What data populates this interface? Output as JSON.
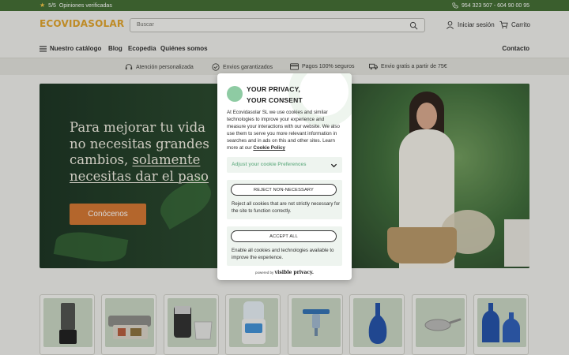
{
  "topbar": {
    "rating": "5/5",
    "reviews": "Opiniones verificadas",
    "phone": "954 323 507 - 604 90 00 95"
  },
  "header": {
    "logo": "ECOVIDASOLAR",
    "search_placeholder": "Buscar",
    "account": "Iniciar sesión",
    "cart": "Carrito"
  },
  "nav": {
    "catalog": "Nuestro catálogo",
    "links": [
      "Blog",
      "Ecopedia",
      "Quiénes somos"
    ],
    "contact": "Contacto"
  },
  "benefits": [
    {
      "icon": "headset-icon",
      "label": "Atención personalizada"
    },
    {
      "icon": "check-circle-icon",
      "label": "Envios garantizados"
    },
    {
      "icon": "credit-card-icon",
      "label": "Pagos 100% seguros"
    },
    {
      "icon": "truck-icon",
      "label": "Envio gratis a partir de 75€"
    }
  ],
  "hero": {
    "line1": "Para mejorar tu vida",
    "line2": "no necesitas grandes",
    "line3": "cambios,",
    "line3_underlined": "solamente",
    "line4_underlined": "necesitas dar el paso",
    "cta": "Conócenos"
  },
  "consent": {
    "title_line1": "YOUR PRIVACY,",
    "title_line2": "YOUR CONSENT",
    "body": "At Ecovidasolar SL we use cookies and similar technologies to improve your experience and measure your interactions with our website. We also use them to serve you more relevant information in searches and in ads on this and other sites. Learn more at our",
    "policy_link": "Cookie Policy",
    "adjust": "Adjust your cookie Preferences",
    "reject_button": "REJECT NON-NECESSARY",
    "reject_desc": "Reject all cookies that are not strictly necessary for the site to function correctly.",
    "accept_button": "ACCEPT ALL",
    "accept_desc": "Enable all cookies and technologies available to improve the experience.",
    "powered_by": "powered by",
    "powered_brand": "visible privacy."
  },
  "colors": {
    "topbar": "#3f6b2f",
    "accent_orange": "#d4742e",
    "consent_green": "#8ecba3",
    "logo_yellow": "#e0a126"
  },
  "products": [
    {
      "name": "blender"
    },
    {
      "name": "vacuum-sealer"
    },
    {
      "name": "water-distiller"
    },
    {
      "name": "water-filter-dispenser"
    },
    {
      "name": "glass-dropper"
    },
    {
      "name": "blue-glass-carafe"
    },
    {
      "name": "steel-frying-pan"
    },
    {
      "name": "blue-glass-bottles"
    }
  ]
}
